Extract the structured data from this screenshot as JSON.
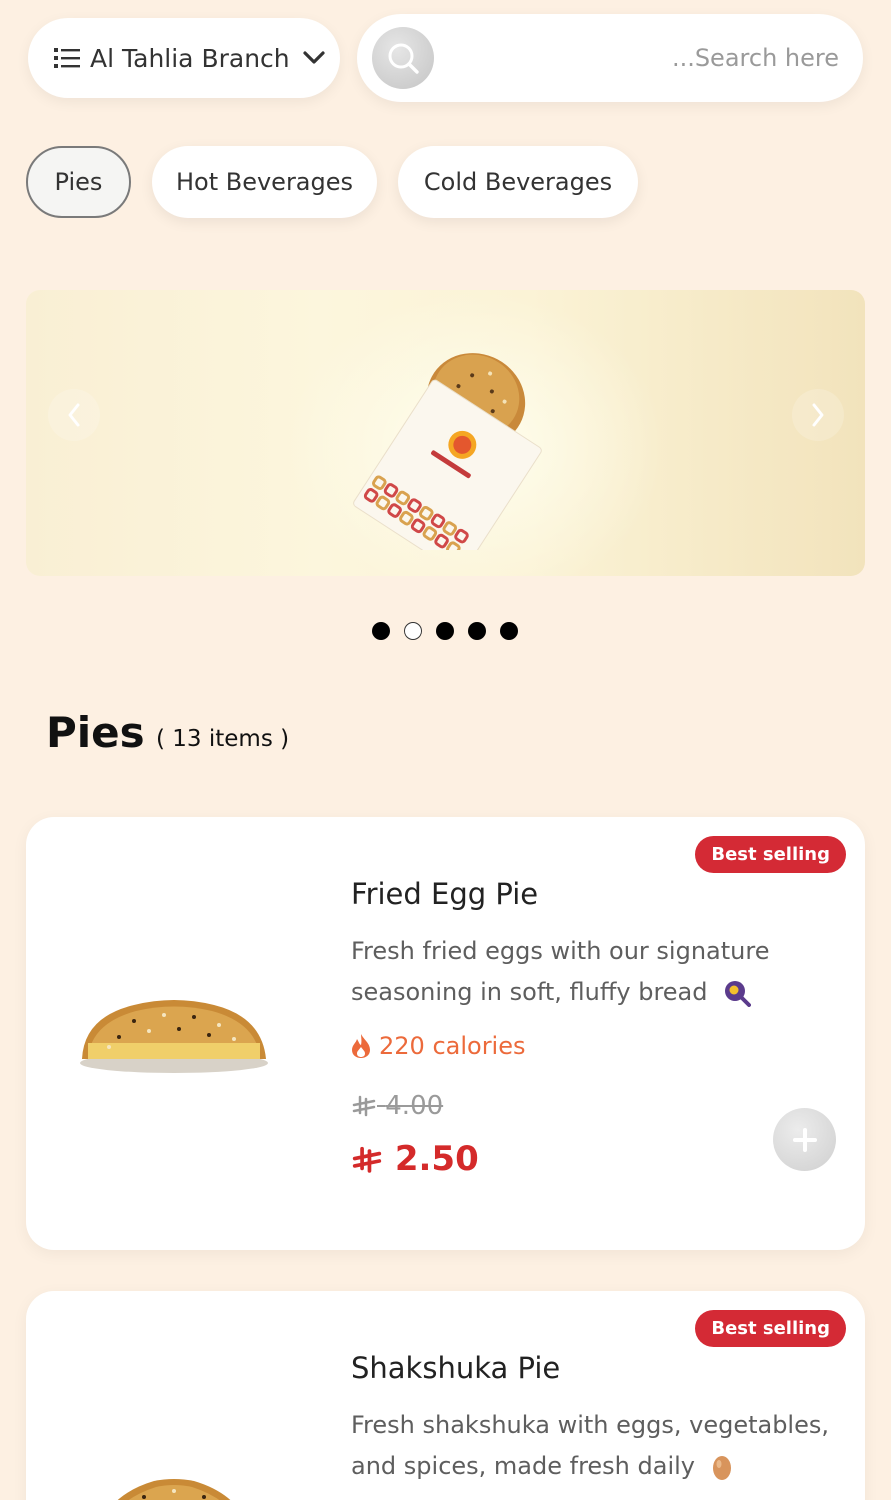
{
  "header": {
    "branch_label": "Al Tahlia Branch",
    "branch_icon": "list-icon",
    "dropdown_icon": "chevron-down-icon",
    "search_icon": "search-icon",
    "search_placeholder": "...Search here",
    "search_value": ""
  },
  "categories": [
    {
      "label": "Pies",
      "active": true
    },
    {
      "label": "Hot Beverages",
      "active": false
    },
    {
      "label": "Cold Beverages",
      "active": false
    }
  ],
  "banner": {
    "prev_icon": "chevron-left-icon",
    "next_icon": "chevron-right-icon",
    "slide_count": 5,
    "active_slide_index": 1
  },
  "section": {
    "title": "Pies",
    "count": "( 13 items )"
  },
  "products": [
    {
      "badge": "Best selling",
      "name": "Fried Egg Pie",
      "description": "Fresh fried eggs with our signature seasoning in soft, fluffy bread",
      "description_icon": "fried-egg-icon",
      "calories": "220 calories",
      "calories_icon": "flame-icon",
      "old_price": "4.00",
      "price": "2.50",
      "currency_icon": "riyal-icon"
    },
    {
      "badge": "Best selling",
      "name": "Shakshuka Pie",
      "description": "Fresh shakshuka with eggs, vegetables, and spices, made fresh daily",
      "description_icon": "egg-icon"
    }
  ],
  "colors": {
    "background": "#fdf0e2",
    "badge": "#d42a35",
    "price": "#d42a2a",
    "calories": "#ec6a3b"
  }
}
